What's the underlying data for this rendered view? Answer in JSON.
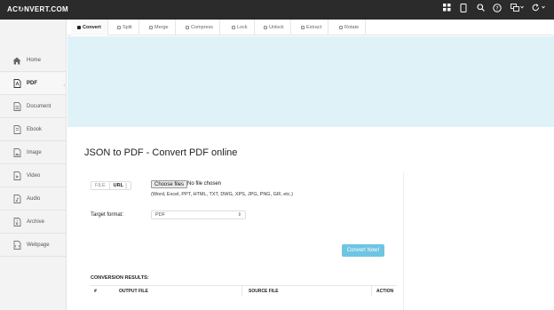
{
  "topbar": {
    "logo": "AC",
    "logo_glyph": "↻",
    "logo_rest": "NVERT.COM",
    "icons": [
      "grid-icon",
      "mobile-icon",
      "search-icon",
      "help-icon",
      "language-icon",
      "refresh-icon"
    ]
  },
  "sidebar": {
    "items": [
      {
        "label": "Home",
        "icon": "home-icon"
      },
      {
        "label": "PDF",
        "icon": "pdf-icon"
      },
      {
        "label": "Document",
        "icon": "document-icon"
      },
      {
        "label": "Ebook",
        "icon": "ebook-icon"
      },
      {
        "label": "Image",
        "icon": "image-icon"
      },
      {
        "label": "Video",
        "icon": "video-icon"
      },
      {
        "label": "Audio",
        "icon": "audio-icon"
      },
      {
        "label": "Archive",
        "icon": "archive-icon"
      },
      {
        "label": "Webpage",
        "icon": "webpage-icon"
      }
    ]
  },
  "tabs": [
    {
      "label": "Convert"
    },
    {
      "label": "Split"
    },
    {
      "label": "Merge"
    },
    {
      "label": "Compress"
    },
    {
      "label": "Lock"
    },
    {
      "label": "Unlock"
    },
    {
      "label": "Extract"
    },
    {
      "label": "Rotate"
    }
  ],
  "main": {
    "title": "JSON to PDF - Convert PDF online",
    "source_toggle": {
      "file": "FILE",
      "url": "URL",
      "more": "⋮"
    },
    "choose_files": "Choose files",
    "no_file": "No file chosen",
    "formats": "(Word, Excel, PPT, HTML, TXT, DWG, XPS, JPG, PNG, GIF, etc.)",
    "target_format_label": "Target format:",
    "target_format_value": "PDF",
    "convert_button": "Convert Now!",
    "results_label": "CONVERSION RESULTS:",
    "results_columns": [
      "#",
      "OUTPUT FILE",
      "SOURCE FILE",
      "ACTION"
    ]
  },
  "colors": {
    "topbar": "#2b2b2b",
    "banner": "#dff2f8",
    "convert_button": "#6ec5e3"
  }
}
